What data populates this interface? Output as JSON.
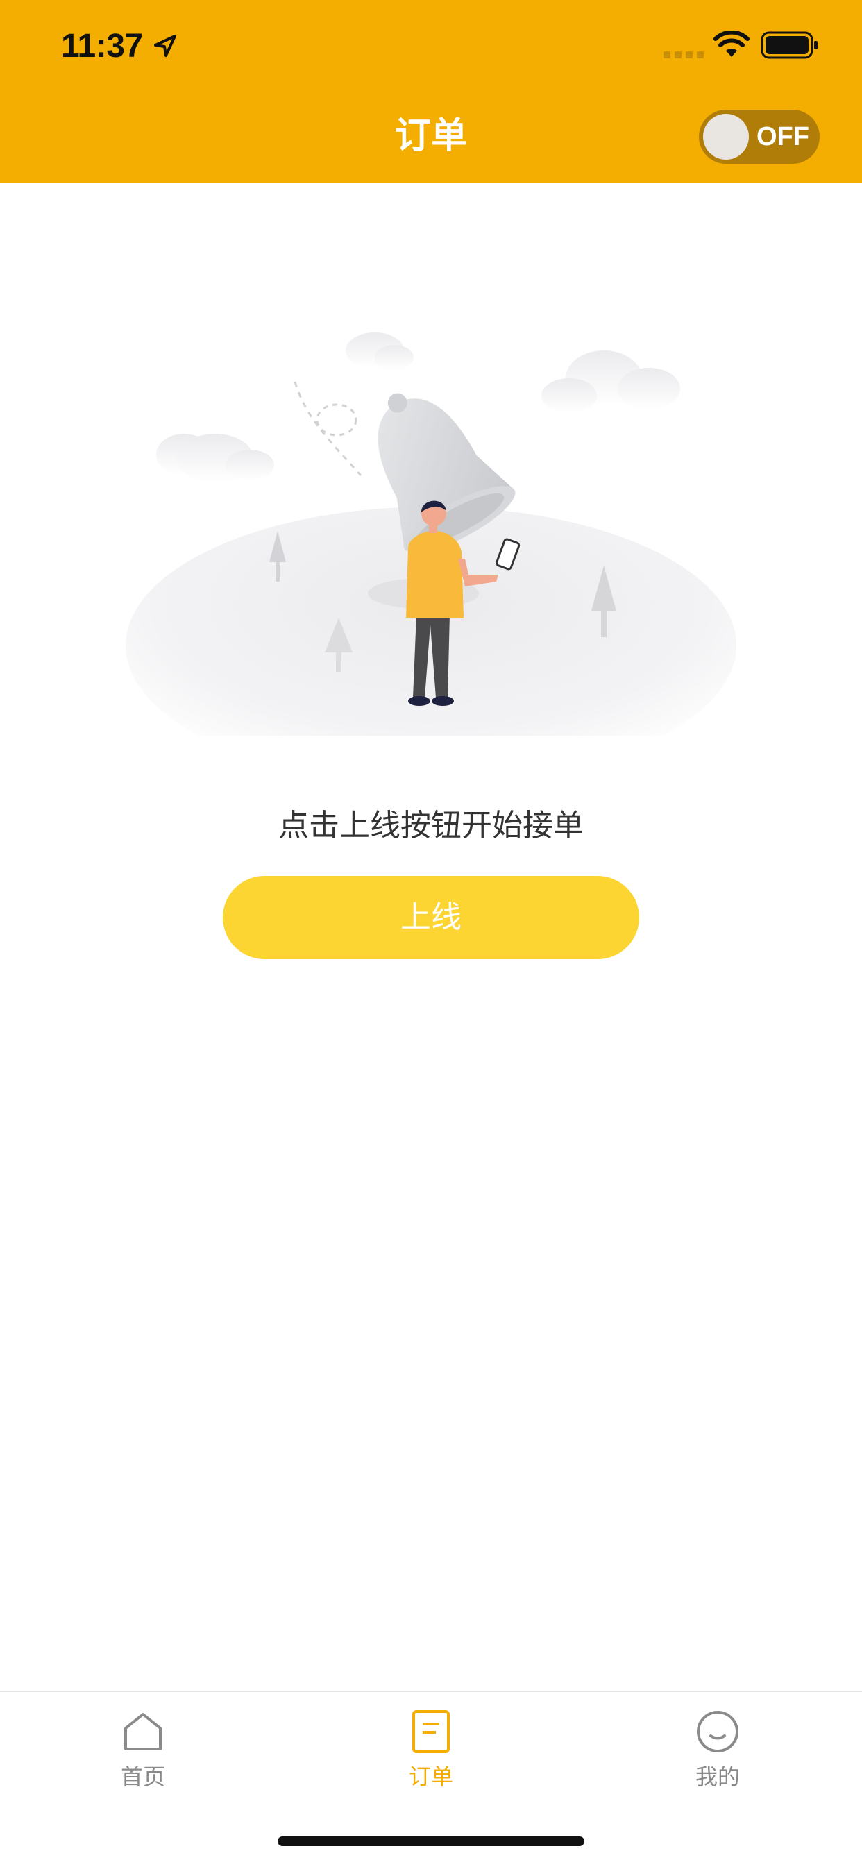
{
  "status_bar": {
    "time": "11:37",
    "icons": [
      "location-arrow-icon",
      "cellular-signal-icon",
      "wifi-icon",
      "battery-icon"
    ]
  },
  "nav": {
    "title": "订单",
    "toggle": {
      "label": "OFF",
      "state": "off"
    }
  },
  "empty_state": {
    "illustration": "person-with-bell-illustration",
    "hint": "点击上线按钮开始接单",
    "button_label": "上线"
  },
  "tabbar": {
    "active": "orders",
    "tabs": [
      {
        "id": "home",
        "label": "首页",
        "icon": "home-icon"
      },
      {
        "id": "orders",
        "label": "订单",
        "icon": "orders-icon"
      },
      {
        "id": "mine",
        "label": "我的",
        "icon": "smile-face-icon"
      }
    ]
  },
  "colors": {
    "header": "#f4ae02",
    "toggle_track": "#b07e08",
    "primary_button": "#fdd532",
    "tab_active": "#f4ae02",
    "tab_inactive": "#8a8a8a"
  }
}
